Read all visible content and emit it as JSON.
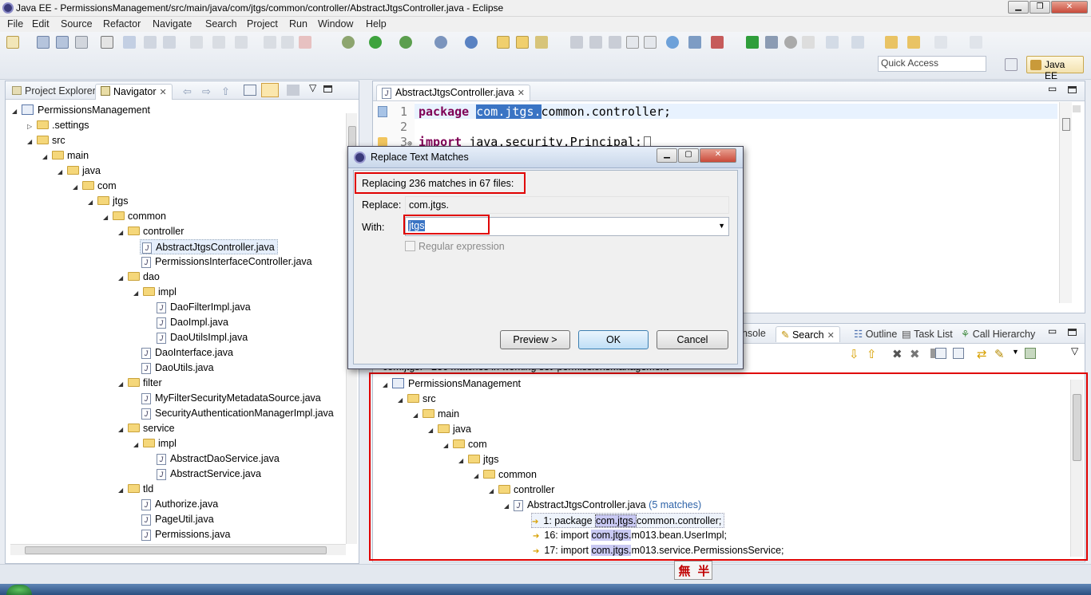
{
  "window": {
    "title": "Java EE - PermissionsManagement/src/main/java/com/jtgs/common/controller/AbstractJtgsController.java - Eclipse",
    "minimize": "▁",
    "maximize": "❐",
    "close": "✕"
  },
  "menu": [
    "File",
    "Edit",
    "Source",
    "Refactor",
    "Navigate",
    "Search",
    "Project",
    "Run",
    "Window",
    "Help"
  ],
  "toolbar": {
    "quick_access_placeholder": "Quick Access",
    "perspective": "Java EE"
  },
  "left_panel": {
    "tabs": [
      "Project Explorer",
      "Navigator"
    ],
    "tree": [
      {
        "label": "PermissionsManagement",
        "type": "project",
        "indent": 0,
        "expanded": true
      },
      {
        "label": ".settings",
        "type": "folder",
        "indent": 1,
        "expanded": false
      },
      {
        "label": "src",
        "type": "folder",
        "indent": 1,
        "expanded": true
      },
      {
        "label": "main",
        "type": "folder",
        "indent": 2,
        "expanded": true
      },
      {
        "label": "java",
        "type": "folder",
        "indent": 3,
        "expanded": true
      },
      {
        "label": "com",
        "type": "folder",
        "indent": 4,
        "expanded": true
      },
      {
        "label": "jtgs",
        "type": "folder",
        "indent": 5,
        "expanded": true
      },
      {
        "label": "common",
        "type": "folder",
        "indent": 6,
        "expanded": true
      },
      {
        "label": "controller",
        "type": "folder",
        "indent": 7,
        "expanded": true
      },
      {
        "label": "AbstractJtgsController.java",
        "type": "file",
        "indent": 8,
        "selected": true
      },
      {
        "label": "PermissionsInterfaceController.java",
        "type": "file",
        "indent": 8
      },
      {
        "label": "dao",
        "type": "folder",
        "indent": 7,
        "expanded": true
      },
      {
        "label": "impl",
        "type": "folder",
        "indent": 8,
        "expanded": true
      },
      {
        "label": "DaoFilterImpl.java",
        "type": "file",
        "indent": 9
      },
      {
        "label": "DaoImpl.java",
        "type": "file",
        "indent": 9
      },
      {
        "label": "DaoUtilsImpl.java",
        "type": "file",
        "indent": 9
      },
      {
        "label": "DaoInterface.java",
        "type": "file",
        "indent": 8
      },
      {
        "label": "DaoUtils.java",
        "type": "file",
        "indent": 8
      },
      {
        "label": "filter",
        "type": "folder",
        "indent": 7,
        "expanded": true
      },
      {
        "label": "MyFilterSecurityMetadataSource.java",
        "type": "file",
        "indent": 8
      },
      {
        "label": "SecurityAuthenticationManagerImpl.java",
        "type": "file",
        "indent": 8
      },
      {
        "label": "service",
        "type": "folder",
        "indent": 7,
        "expanded": true
      },
      {
        "label": "impl",
        "type": "folder",
        "indent": 8,
        "expanded": true
      },
      {
        "label": "AbstractDaoService.java",
        "type": "file",
        "indent": 9
      },
      {
        "label": "AbstractService.java",
        "type": "file",
        "indent": 9
      },
      {
        "label": "tld",
        "type": "folder",
        "indent": 7,
        "expanded": true
      },
      {
        "label": "Authorize.java",
        "type": "file",
        "indent": 8
      },
      {
        "label": "PageUtil.java",
        "type": "file",
        "indent": 8
      },
      {
        "label": "Permissions.java",
        "type": "file",
        "indent": 8
      }
    ]
  },
  "editor": {
    "tab": "AbstractJtgsController.java",
    "lines": [
      {
        "num": "1",
        "kw": "package",
        "hl": "com.jtgs.",
        "rest": "common.controller;"
      },
      {
        "num": "2",
        "kw": "",
        "hl": "",
        "rest": ""
      },
      {
        "num": "3",
        "kw": "import",
        "hl": "",
        "rest": "java.security.Principal;"
      }
    ]
  },
  "bottom_panel": {
    "tabs": [
      "Console",
      "Search",
      "Outline",
      "Task List",
      "Call Hierarchy"
    ],
    "summary": "com.jtgs. - 236 matches in working set 'permissionsManagement'",
    "tree": [
      {
        "label": "PermissionsManagement",
        "type": "project",
        "indent": 0
      },
      {
        "label": "src",
        "type": "folder",
        "indent": 1
      },
      {
        "label": "main",
        "type": "folder",
        "indent": 2
      },
      {
        "label": "java",
        "type": "folder",
        "indent": 3
      },
      {
        "label": "com",
        "type": "folder",
        "indent": 4
      },
      {
        "label": "jtgs",
        "type": "folder",
        "indent": 5
      },
      {
        "label": "common",
        "type": "folder",
        "indent": 6
      },
      {
        "label": "controller",
        "type": "folder",
        "indent": 7
      },
      {
        "label": "AbstractJtgsController.java",
        "count": "(5 matches)",
        "type": "file",
        "indent": 8
      }
    ],
    "matches": [
      {
        "prefix": "1: package ",
        "hit": "com.jtgs.",
        "rest": "common.controller;",
        "selected": true
      },
      {
        "prefix": "16: import ",
        "hit": "com.jtgs.",
        "rest": "m013.bean.UserImpl;"
      },
      {
        "prefix": "17: import ",
        "hit": "com.jtgs.",
        "rest": "m013.service.PermissionsService;"
      }
    ]
  },
  "dialog": {
    "title": "Replace Text Matches",
    "info": "Replacing 236 matches in 67 files:",
    "replace_label": "Replace:",
    "replace_value": "com.jtgs.",
    "with_label": "With:",
    "with_value": "jtgs",
    "regex_label": "Regular expression",
    "regex_checked": false,
    "preview": "Preview >",
    "ok": "OK",
    "cancel": "Cancel"
  },
  "ime": [
    "無",
    "半"
  ],
  "colors": {
    "annotation": "#e00000",
    "keyword": "#7f0055",
    "selection": "#3a74c4"
  }
}
